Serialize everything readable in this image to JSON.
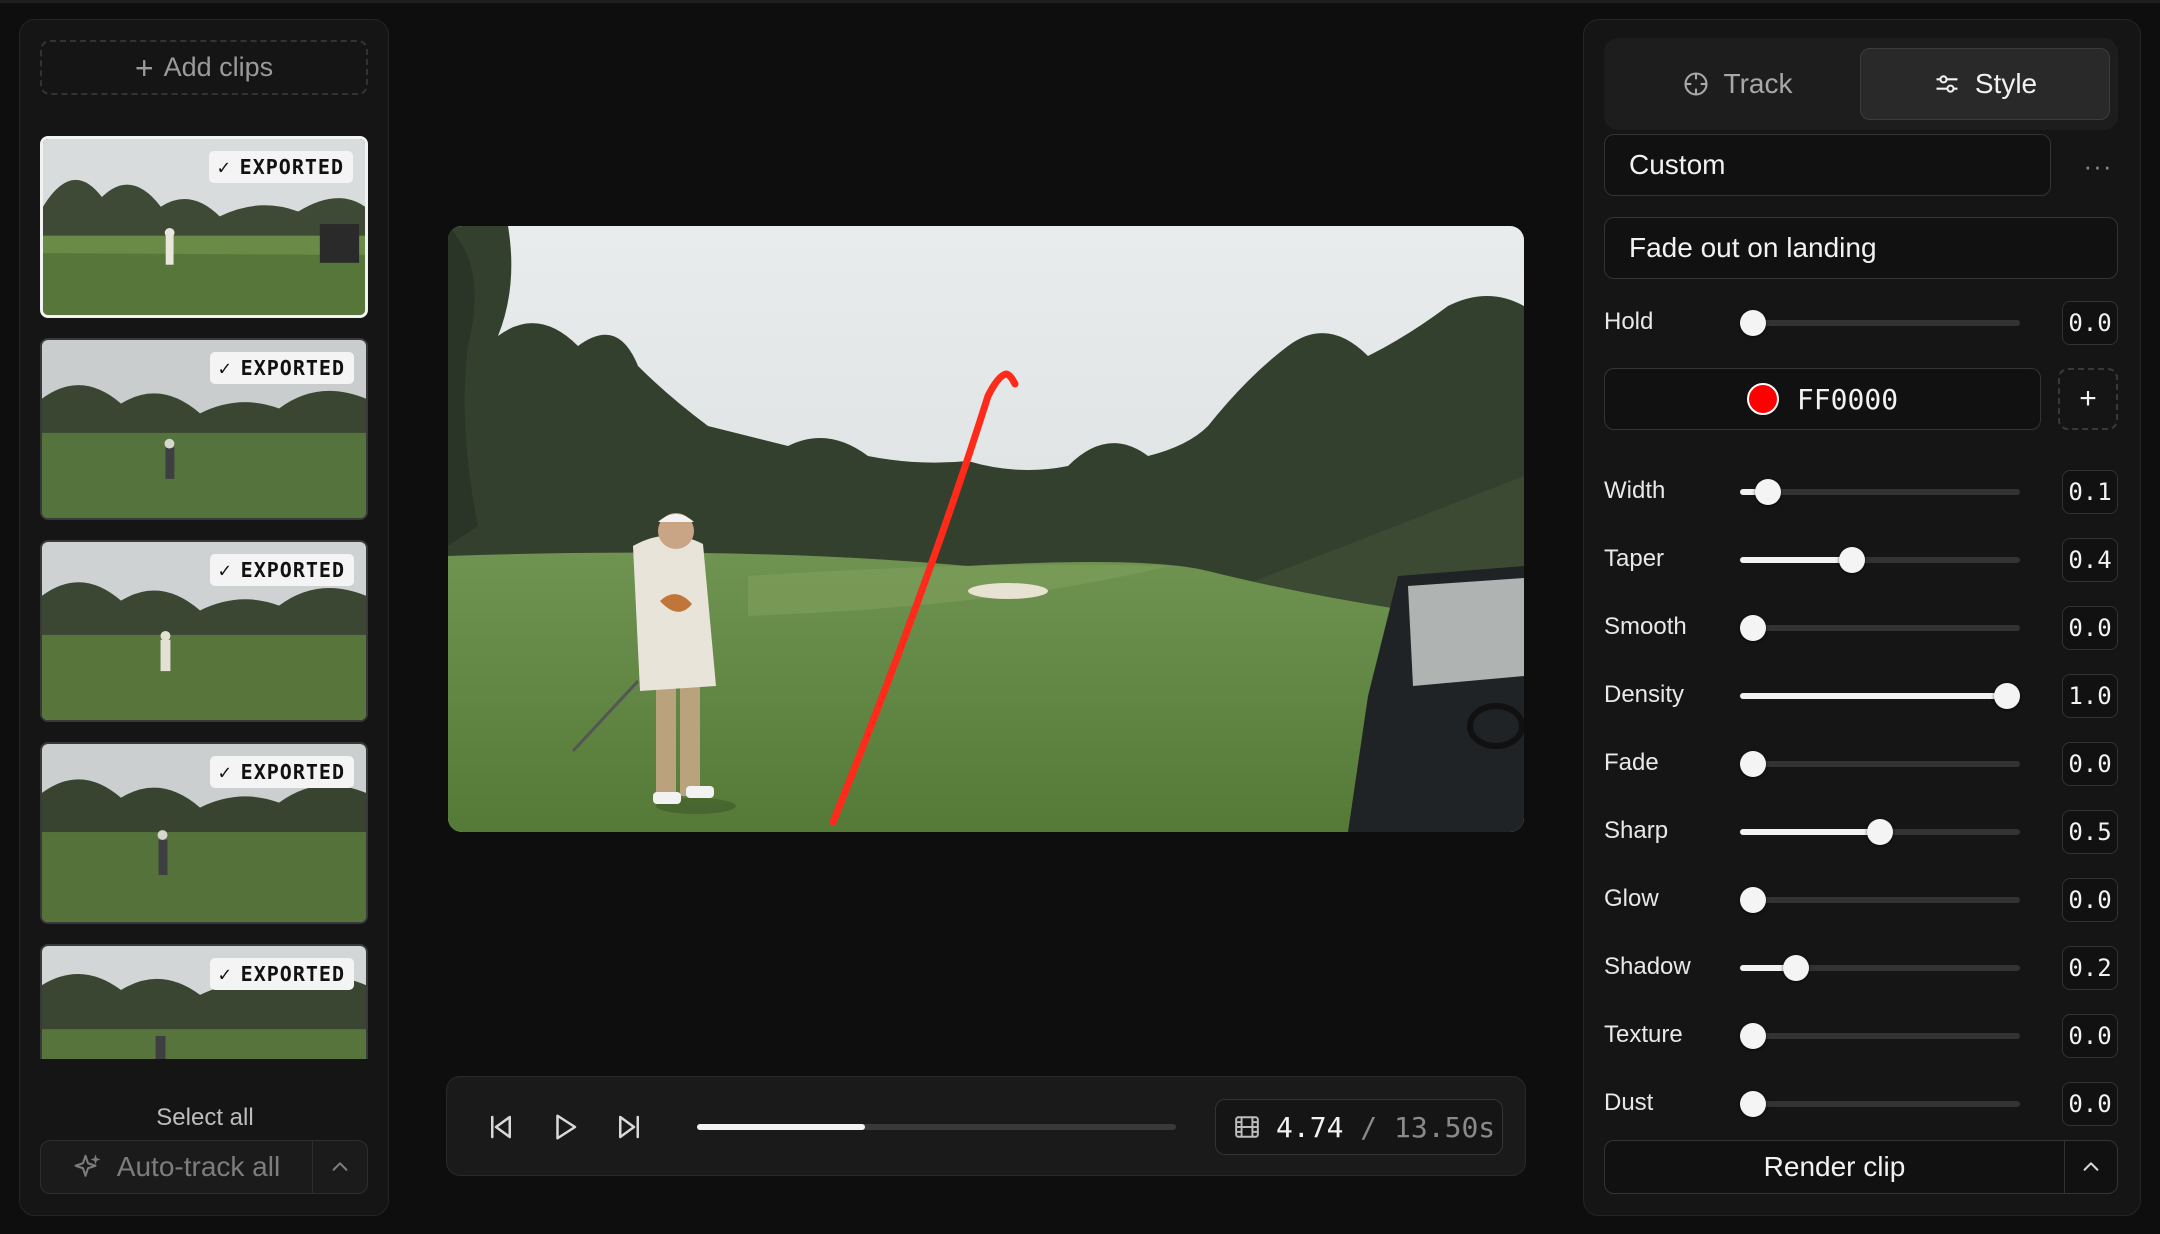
{
  "left_panel": {
    "add_clips_label": "Add clips",
    "clips": [
      {
        "badge": "EXPORTED",
        "check": "✓",
        "selected": true
      },
      {
        "badge": "EXPORTED",
        "check": "✓",
        "selected": false
      },
      {
        "badge": "EXPORTED",
        "check": "✓",
        "selected": false
      },
      {
        "badge": "EXPORTED",
        "check": "✓",
        "selected": false
      },
      {
        "badge": "EXPORTED",
        "check": "✓",
        "selected": false
      }
    ],
    "select_all_label": "Select all",
    "auto_track_label": "Auto-track all"
  },
  "player": {
    "current_time": "4.74",
    "separator": "/",
    "total_time": "13.50s",
    "progress": 0.35
  },
  "right_panel": {
    "tabs": [
      {
        "label": "Track",
        "icon": "crosshair-icon",
        "active": false
      },
      {
        "label": "Style",
        "icon": "sliders-icon",
        "active": true
      }
    ],
    "preset": "Custom",
    "more_label": "···",
    "fade_option": "Fade out on landing",
    "hold": {
      "label": "Hold",
      "value": "0.0",
      "fraction": 0.0
    },
    "color": {
      "hex": "FF0000",
      "swatch": "#ff0000",
      "add_label": "+"
    },
    "sliders": [
      {
        "label": "Width",
        "value": "0.1",
        "fraction": 0.1
      },
      {
        "label": "Taper",
        "value": "0.4",
        "fraction": 0.4
      },
      {
        "label": "Smooth",
        "value": "0.0",
        "fraction": 0.0
      },
      {
        "label": "Density",
        "value": "1.0",
        "fraction": 1.0
      },
      {
        "label": "Fade",
        "value": "0.0",
        "fraction": 0.03
      },
      {
        "label": "Sharp",
        "value": "0.5",
        "fraction": 0.5
      },
      {
        "label": "Glow",
        "value": "0.0",
        "fraction": 0.0
      },
      {
        "label": "Shadow",
        "value": "0.2",
        "fraction": 0.2
      },
      {
        "label": "Texture",
        "value": "0.0",
        "fraction": 0.0
      },
      {
        "label": "Dust",
        "value": "0.0",
        "fraction": 0.0
      }
    ],
    "render_label": "Render clip"
  },
  "colors": {
    "accent": "#f2f2f2",
    "tracer": "#ff2a1a",
    "panel": "#161515"
  }
}
